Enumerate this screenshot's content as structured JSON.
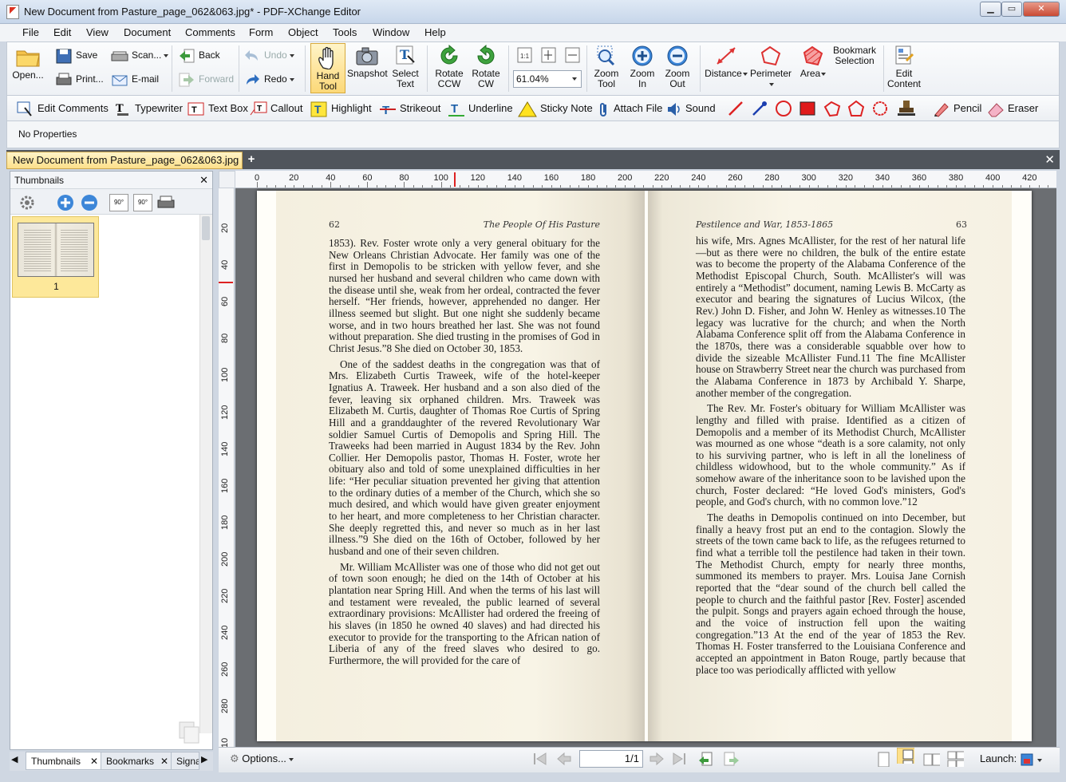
{
  "window": {
    "title": "New Document from Pasture_page_062&063.jpg* - PDF-XChange Editor"
  },
  "menu": [
    "File",
    "Edit",
    "View",
    "Document",
    "Comments",
    "Form",
    "Object",
    "Tools",
    "Window",
    "Help"
  ],
  "ribbon": {
    "open": "Open...",
    "save": "Save",
    "print": "Print...",
    "scan": "Scan...",
    "email": "E-mail",
    "back": "Back",
    "forward": "Forward",
    "undo": "Undo",
    "redo": "Redo",
    "hand_tool": [
      "Hand",
      "Tool"
    ],
    "snapshot": "Snapshot",
    "select_text": [
      "Select",
      "Text"
    ],
    "rotate_ccw": [
      "Rotate",
      "CCW"
    ],
    "rotate_cw": [
      "Rotate",
      "CW"
    ],
    "zoom_value": "61.04%",
    "zoom_tool": [
      "Zoom",
      "Tool"
    ],
    "zoom_in": [
      "Zoom",
      "In"
    ],
    "zoom_out": [
      "Zoom",
      "Out"
    ],
    "distance": "Distance",
    "perimeter": "Perimeter",
    "area": "Area",
    "bookmark_selection": [
      "Bookmark",
      "Selection"
    ],
    "edit_content": [
      "Edit",
      "Content"
    ]
  },
  "comment_tools": {
    "edit_comments": "Edit Comments",
    "typewriter": "Typewriter",
    "text_box": "Text Box",
    "callout": "Callout",
    "highlight": "Highlight",
    "strikeout": "Strikeout",
    "underline": "Underline",
    "sticky_note": "Sticky Note",
    "attach_file": "Attach File",
    "sound": "Sound",
    "pencil": "Pencil",
    "eraser": "Eraser"
  },
  "properties": {
    "label": "No Properties"
  },
  "document_tab": {
    "label": "New Document from Pasture_page_062&063.jpg *"
  },
  "thumbnails": {
    "title": "Thumbnails",
    "rotate_left": "90°",
    "rotate_right": "90°",
    "page_number": "1"
  },
  "left_tabs": [
    "Thumbnails",
    "Bookmarks",
    "Signa"
  ],
  "ruler": {
    "h_labels": [
      "0",
      "20",
      "40",
      "60",
      "80",
      "100",
      "120",
      "140",
      "160",
      "180",
      "200",
      "220",
      "240",
      "260",
      "280",
      "300",
      "320",
      "340",
      "360",
      "380",
      "400",
      "420"
    ],
    "v_labels": [
      "20",
      "40",
      "60",
      "80",
      "100",
      "120",
      "140",
      "160",
      "180",
      "200",
      "220",
      "240",
      "260",
      "280",
      "10"
    ]
  },
  "left_page": {
    "page_number": "62",
    "running_head": "The People Of His Pasture",
    "paragraphs": [
      "1853). Rev. Foster wrote only a very general obituary for the New Orleans Christian Advocate. Her family was one of the first in Demopolis to be stricken with yellow fever, and she nursed her husband and several children who came down with the disease until she, weak from her ordeal, contracted the fever herself. “Her friends, however, apprehended no danger. Her illness seemed but slight. But one night she suddenly became worse, and in two hours breathed her last. She was not found without preparation. She died trusting in the promises of God in Christ Jesus.”8 She died on October 30, 1853.",
      "One of the saddest deaths in the congregation was that of Mrs. Elizabeth Curtis Traweek, wife of the hotel-keeper Ignatius A. Traweek. Her husband and a son also died of the fever, leaving six orphaned children. Mrs. Traweek was Elizabeth M. Curtis, daughter of Thomas Roe Curtis of Spring Hill and a granddaughter of the revered Revolutionary War soldier Samuel Curtis of Demopolis and Spring Hill. The Traweeks had been married in August 1834 by the Rev. John Collier. Her Demopolis pastor, Thomas H. Foster, wrote her obituary also and told of some unexplained difficulties in her life: “Her peculiar situation prevented her giving that attention to the ordinary duties of a member of the Church, which she so much desired, and which would have given greater enjoyment to her heart, and more completeness to her Christian character. She deeply regretted this, and never so much as in her last illness.”9 She died on the 16th of October, followed by her husband and one of their seven children.",
      "Mr. William McAllister was one of those who did not get out of town soon enough; he died on the 14th of October at his plantation near Spring Hill. And when the terms of his last will and testament were revealed, the public learned of several extraordinary provisions: McAllister had ordered the freeing of his slaves (in 1850 he owned 40 slaves) and had directed his executor to provide for the transporting to the African nation of Liberia of any of the freed slaves who desired to go. Furthermore, the will provided for the care of"
    ]
  },
  "right_page": {
    "page_number": "63",
    "running_head": "Pestilence and War, 1853-1865",
    "paragraphs": [
      "his wife, Mrs. Agnes McAllister, for the rest of her natural life—but as there were no children, the bulk of the entire estate was to become the property of the Alabama Conference of the Methodist Episcopal Church, South. McAllister's will was entirely a “Methodist” document, naming Lewis B. McCarty as executor and bearing the signatures of Lucius Wilcox, (the Rev.) John D. Fisher, and John W. Henley as witnesses.10 The legacy was lucrative for the church; and when the North Alabama Conference split off from the Alabama Conference in the 1870s, there was a considerable squabble over how to divide the sizeable McAllister Fund.11 The fine McAllister house on Strawberry Street near the church was purchased from the Alabama Conference in 1873 by Archibald Y. Sharpe, another member of the congregation.",
      "The Rev. Mr. Foster's obituary for William McAllister was lengthy and filled with praise. Identified as a citizen of Demopolis and a member of its Methodist Church, McAllister was mourned as one whose “death is a sore calamity, not only to his surviving partner, who is left in all the loneliness of childless widowhood, but to the whole community.” As if somehow aware of the inheritance soon to be lavished upon the church, Foster declared: “He loved God's ministers, God's people, and God's church, with no common love.”12",
      "The deaths in Demopolis continued on into December, but finally a heavy frost put an end to the contagion. Slowly the streets of the town came back to life, as the refugees returned to find what a terrible toll the pestilence had taken in their town. The Methodist Church, empty for nearly three months, summoned its members to prayer. Mrs. Louisa Jane Cornish reported that the “dear sound of the church bell called the people to church and the faithful pastor [Rev. Foster] ascended the pulpit. Songs and prayers again echoed through the house, and the voice of instruction fell upon the waiting congregation.”13 At the end of the year of 1853 the Rev. Thomas H. Foster transferred to the Louisiana Conference and accepted an appointment in Baton Rouge, partly because that place too was periodically afflicted with yellow"
    ]
  },
  "statusbar": {
    "options": "Options...",
    "page_indicator": "1/1",
    "launch": "Launch:"
  },
  "colors": {
    "accent": "#fde08a",
    "doc_bg": "#6b6e72",
    "chrome": "#cfd7e2"
  }
}
